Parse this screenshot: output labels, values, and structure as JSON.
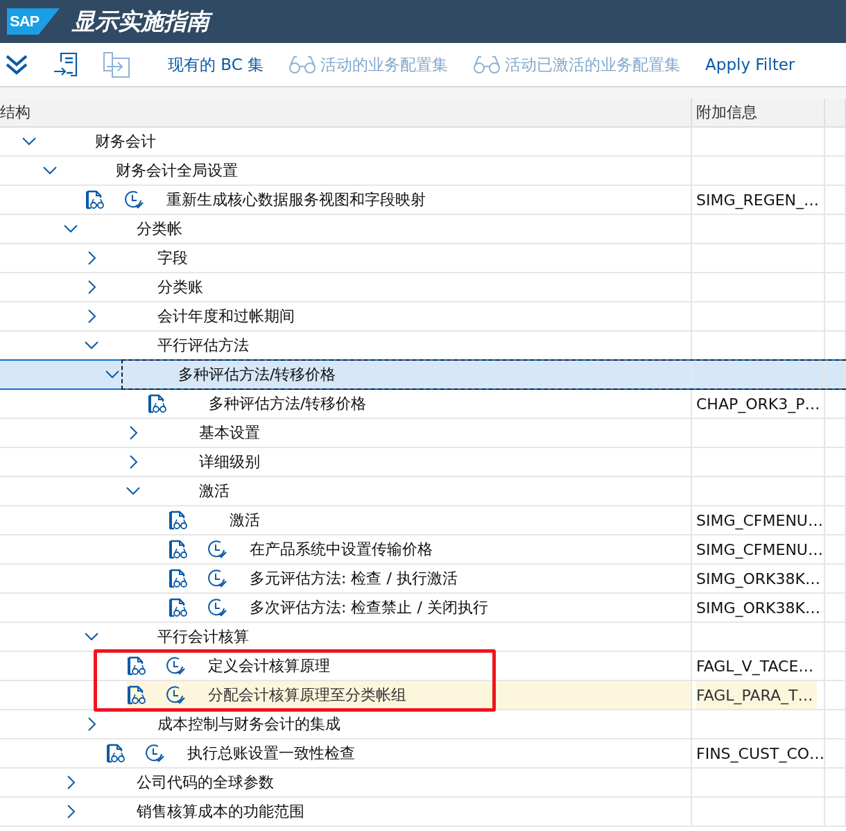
{
  "title_bar": {
    "logo": "SAP",
    "title": "显示实施指南"
  },
  "toolbar": {
    "icon_buttons": [
      {
        "disabled": false
      },
      {
        "disabled": false
      },
      {
        "disabled": true
      }
    ],
    "text_buttons": [
      {
        "label": "现有的 BC 集",
        "kind": "plain",
        "disabled": false
      },
      {
        "label": "活动的业务配置集",
        "kind": "glasses",
        "disabled": true
      },
      {
        "label": "活动已激活的业务配置集",
        "kind": "glasses",
        "disabled": true
      },
      {
        "label": "Apply Filter",
        "kind": "plain",
        "disabled": false
      }
    ]
  },
  "tree": {
    "columns": [
      "结构",
      "附加信息"
    ],
    "nodes": [
      {
        "kind": "folder",
        "label": "财务会计",
        "expanded": true,
        "selected": false,
        "children": [
          {
            "kind": "folder",
            "label": "财务会计全局设置",
            "expanded": true,
            "selected": false,
            "children": [
              {
                "kind": "activity",
                "label": "重新生成核心数据服务视图和字段映射",
                "info": "SIMG_REGEN_…",
                "clock_icon": true,
                "selected": false
              },
              {
                "kind": "folder",
                "label": "分类帐",
                "expanded": true,
                "selected": false,
                "children": [
                  {
                    "kind": "folder",
                    "label": "字段",
                    "expanded": false,
                    "selected": false
                  },
                  {
                    "kind": "folder",
                    "label": "分类账",
                    "expanded": false,
                    "selected": false
                  },
                  {
                    "kind": "folder",
                    "label": "会计年度和过帐期间",
                    "expanded": false,
                    "selected": false
                  },
                  {
                    "kind": "folder",
                    "label": "平行评估方法",
                    "expanded": true,
                    "selected": false,
                    "children": [
                      {
                        "kind": "folder",
                        "label": "多种评估方法/转移价格",
                        "expanded": true,
                        "selected": true,
                        "children": [
                          {
                            "kind": "activity",
                            "label": "多种评估方法/转移价格",
                            "info": "CHAP_ORK3_P…",
                            "clock_icon": false,
                            "selected": false
                          },
                          {
                            "kind": "folder",
                            "label": "基本设置",
                            "expanded": false,
                            "selected": false
                          },
                          {
                            "kind": "folder",
                            "label": "详细级别",
                            "expanded": false,
                            "selected": false
                          },
                          {
                            "kind": "folder",
                            "label": "激活",
                            "expanded": true,
                            "selected": false,
                            "children": [
                              {
                                "kind": "activity",
                                "label": "激活",
                                "info": "SIMG_CFMENU…",
                                "clock_icon": false,
                                "selected": false
                              },
                              {
                                "kind": "activity",
                                "label": "在产品系统中设置传输价格",
                                "info": "SIMG_CFMENU…",
                                "clock_icon": true,
                                "selected": false
                              },
                              {
                                "kind": "activity",
                                "label": "多元评估方法: 检查 / 执行激活",
                                "info": "SIMG_ORK38K…",
                                "clock_icon": true,
                                "selected": false
                              },
                              {
                                "kind": "activity",
                                "label": "多次评估方法: 检查禁止 / 关闭执行",
                                "info": "SIMG_ORK38K…",
                                "clock_icon": true,
                                "selected": false
                              }
                            ]
                          }
                        ]
                      }
                    ]
                  },
                  {
                    "kind": "folder",
                    "label": "平行会计核算",
                    "expanded": true,
                    "selected": false,
                    "children": [
                      {
                        "kind": "activity",
                        "label": "定义会计核算原理",
                        "info": "FAGL_V_TACE…",
                        "clock_icon": true,
                        "selected": false,
                        "boxed": true
                      },
                      {
                        "kind": "activity",
                        "label": "分配会计核算原理至分类帐组",
                        "info": "FAGL_PARA_T…",
                        "clock_icon": true,
                        "selected": false,
                        "highlighted": true,
                        "boxed": true
                      }
                    ]
                  },
                  {
                    "kind": "folder",
                    "label": "成本控制与财务会计的集成",
                    "expanded": false,
                    "selected": false
                  },
                  {
                    "kind": "activity",
                    "label": "执行总账设置一致性检查",
                    "info": "FINS_CUST_CO…",
                    "clock_icon": true,
                    "selected": false
                  }
                ]
              },
              {
                "kind": "folder",
                "label": "公司代码的全球参数",
                "expanded": false,
                "selected": false
              },
              {
                "kind": "folder",
                "label": "销售核算成本的功能范围",
                "expanded": false,
                "selected": false
              }
            ]
          }
        ]
      }
    ]
  }
}
